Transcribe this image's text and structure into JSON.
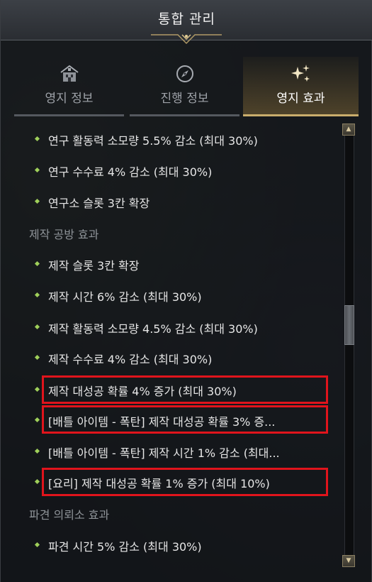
{
  "window": {
    "title": "통합 관리"
  },
  "tabs": [
    {
      "label": "영지 정보",
      "icon": "house-icon",
      "active": false
    },
    {
      "label": "진행 정보",
      "icon": "compass-icon",
      "active": false
    },
    {
      "label": "영지 효과",
      "icon": "sparkle-icon",
      "active": true
    }
  ],
  "items": [
    "연구 활동력 소모량 5.5% 감소 (최대 30%)",
    "연구 수수료 4% 감소 (최대 30%)",
    "연구소 슬롯 3칸 확장"
  ],
  "sections": {
    "workshop": {
      "title": "제작 공방 효과",
      "items": [
        "제작 슬롯 3칸 확장",
        "제작 시간 6% 감소 (최대  30%)",
        "제작 활동력 소모량 4.5% 감소 (최대  30%)",
        "제작 수수료 4% 감소 (최대  30%)",
        "제작 대성공 확률 4% 증가 (최대 30%)",
        "[배틀 아이템 - 폭탄] 제작 대성공 확률 3% 증...",
        "[배틀 아이템 - 폭탄] 제작 시간 1% 감소 (최대...",
        "[요리] 제작 대성공 확률 1% 증가 (최대 10%)"
      ]
    },
    "dispatch": {
      "title": "파견 의뢰소 효과",
      "items": [
        "파견 시간 5% 감소 (최대 30%)"
      ]
    }
  },
  "colors": {
    "accent": "#c9ad6c",
    "bullet": "#9fd05a",
    "highlight": "#e0141c"
  }
}
